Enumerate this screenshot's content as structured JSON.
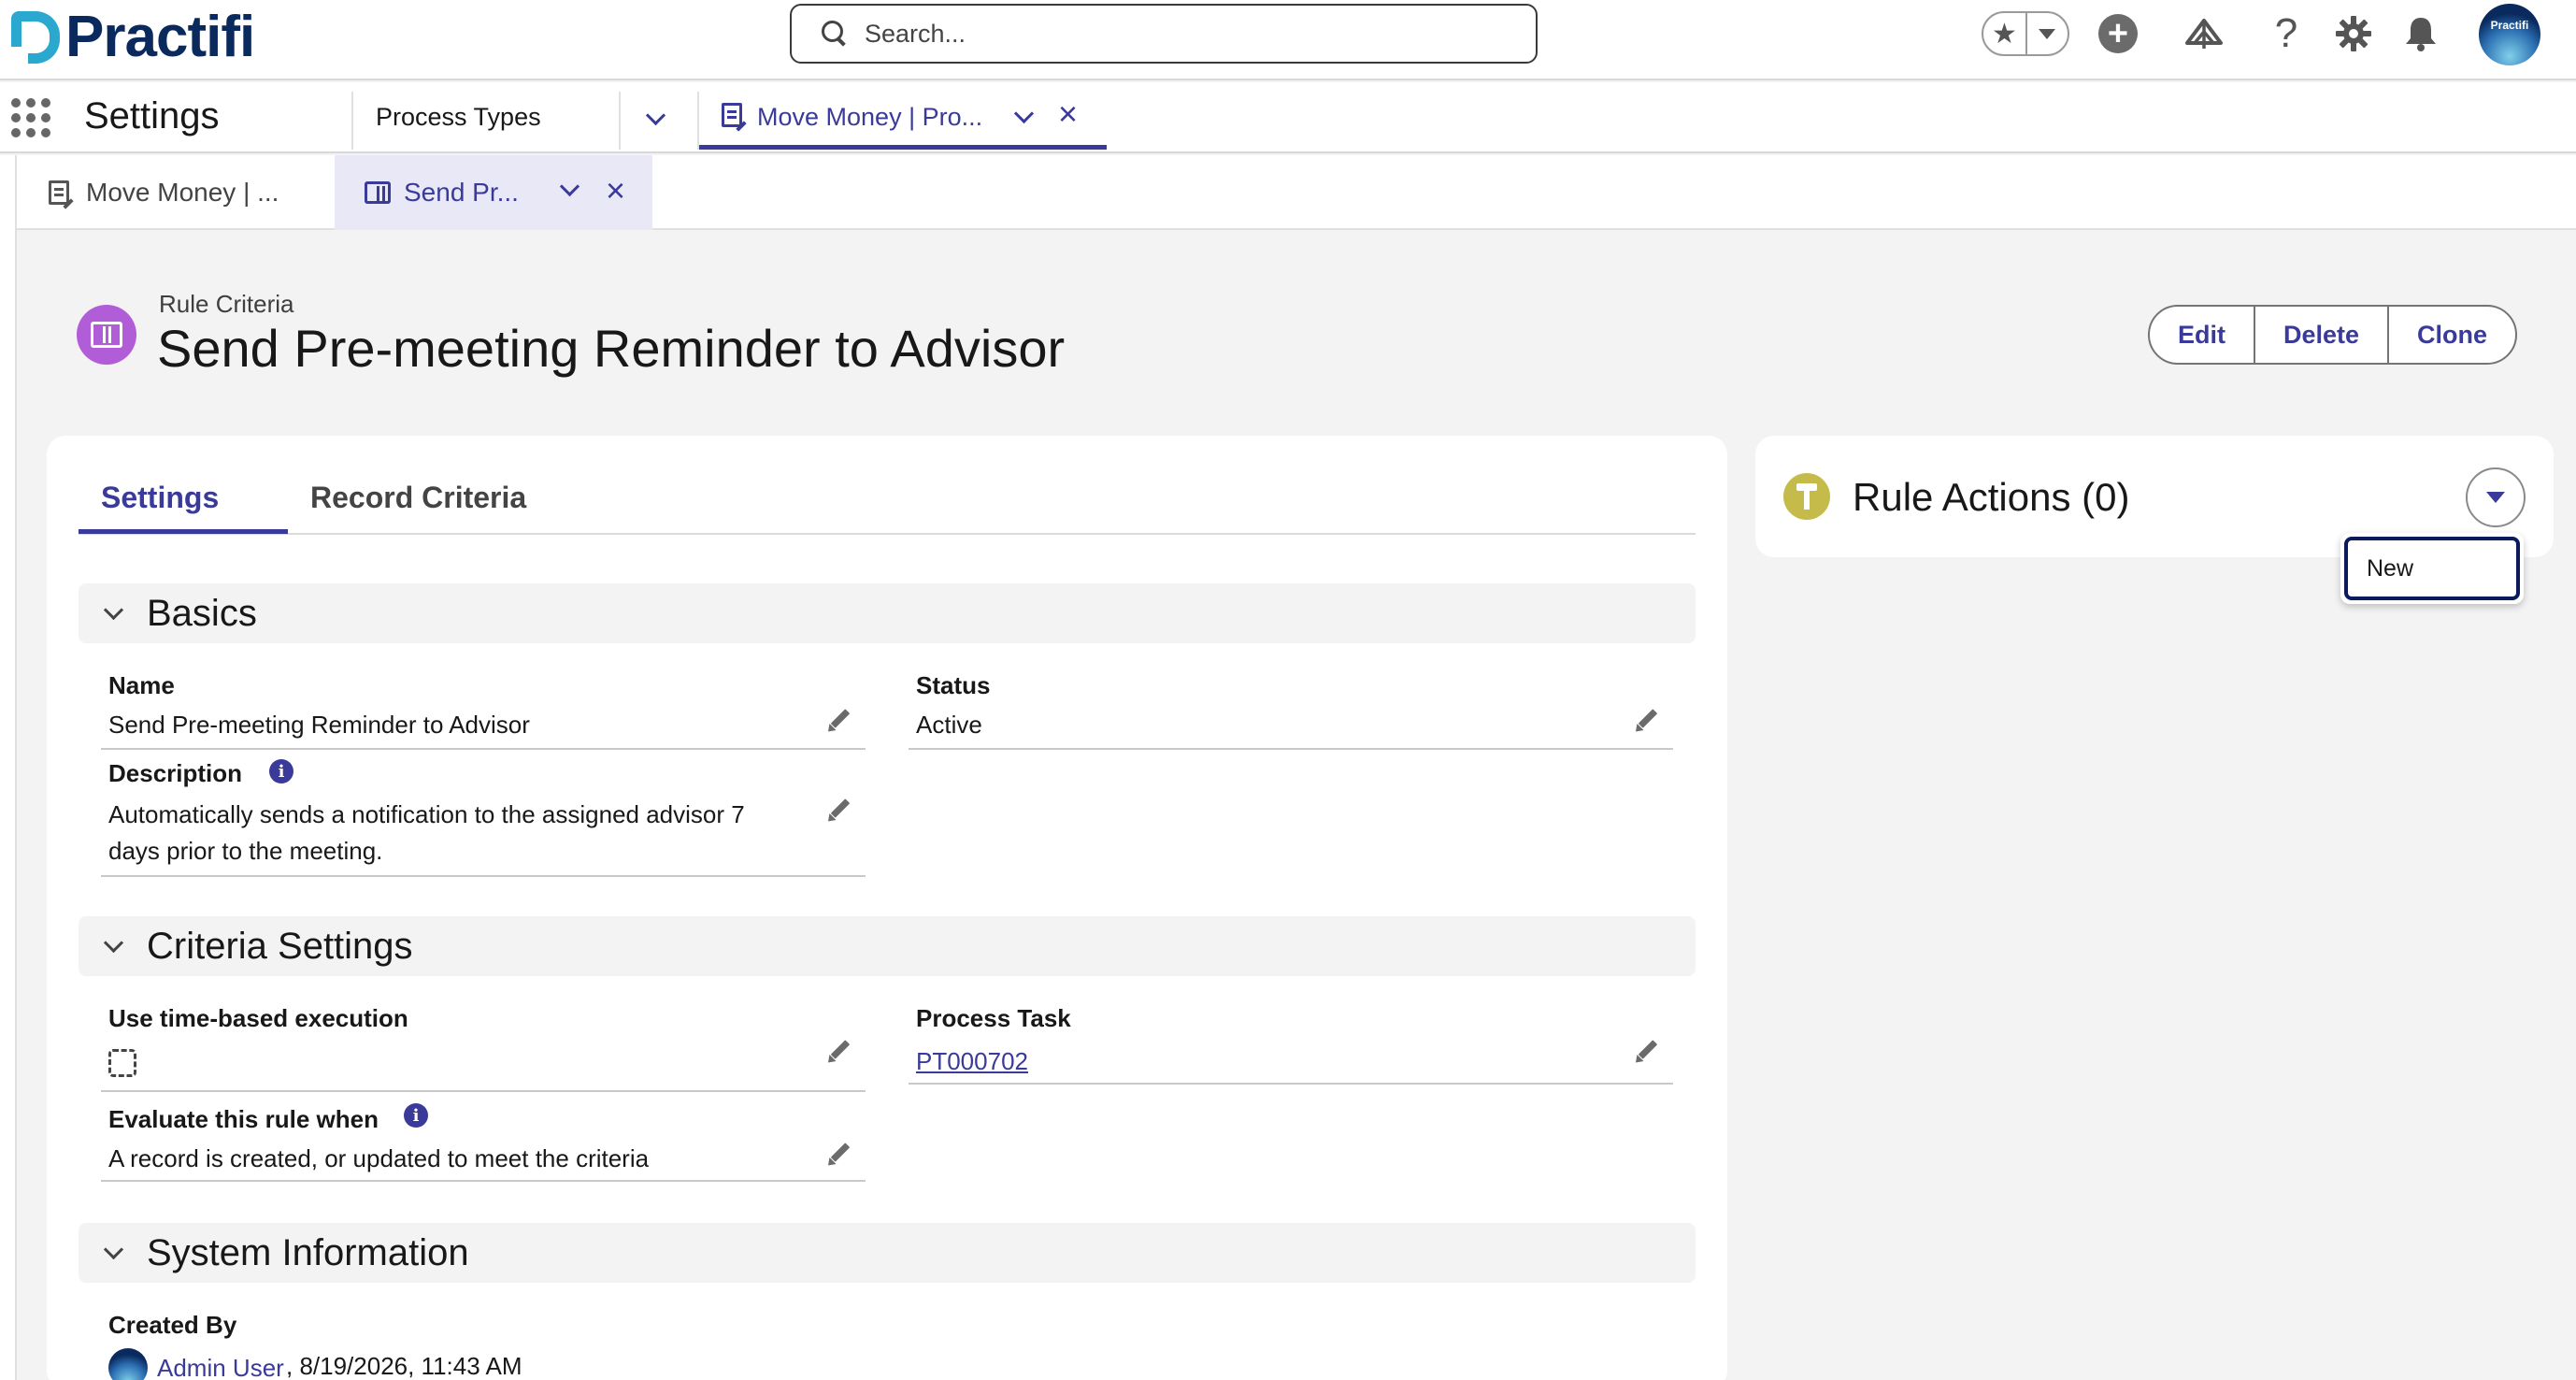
{
  "header": {
    "logo_text": "Practifi",
    "search_placeholder": "Search...",
    "avatar_text": "Practifi"
  },
  "app_nav": {
    "app_name": "Settings",
    "items": [
      {
        "label": "Process Types"
      },
      {
        "label": "Move Money | Pro..."
      }
    ]
  },
  "subtabs": [
    {
      "label": "Move Money | ..."
    },
    {
      "label": "Send Pr..."
    }
  ],
  "record": {
    "object_label": "Rule Criteria",
    "title": "Send Pre-meeting Reminder to Advisor",
    "actions": [
      "Edit",
      "Delete",
      "Clone"
    ]
  },
  "tabs": [
    {
      "label": "Settings",
      "active": true
    },
    {
      "label": "Record Criteria",
      "active": false
    }
  ],
  "sections": {
    "basics": {
      "title": "Basics",
      "name_label": "Name",
      "name_value": "Send Pre-meeting Reminder to Advisor",
      "status_label": "Status",
      "status_value": "Active",
      "description_label": "Description",
      "description_value_1": "Automatically sends a notification to the assigned advisor 7",
      "description_value_2": "days prior to the meeting."
    },
    "criteria": {
      "title": "Criteria Settings",
      "time_based_label": "Use time-based execution",
      "time_based_checked": false,
      "process_task_label": "Process Task",
      "process_task_value": "PT000702",
      "evaluate_label": "Evaluate this rule when",
      "evaluate_value": "A record is created, or updated to meet the criteria"
    },
    "system": {
      "title": "System Information",
      "created_by_label": "Created By",
      "created_by_user": "Admin User",
      "created_by_date": ", 8/19/2026, 11:43 AM"
    }
  },
  "rule_actions": {
    "title": "Rule Actions (0)",
    "menu_items": [
      "New"
    ]
  },
  "colors": {
    "brand": "#3a3a9a",
    "record_icon": "#b25dd8",
    "rule_actions_icon": "#c4bb4a",
    "logo_accent": "#2aa8cf"
  },
  "icons": [
    "search-icon",
    "star-icon",
    "plus-icon",
    "trailhead-icon",
    "help-icon",
    "gear-icon",
    "bell-icon",
    "waffle-icon",
    "document-icon",
    "book-icon",
    "pencil-icon",
    "info-icon",
    "hammer-icon"
  ]
}
